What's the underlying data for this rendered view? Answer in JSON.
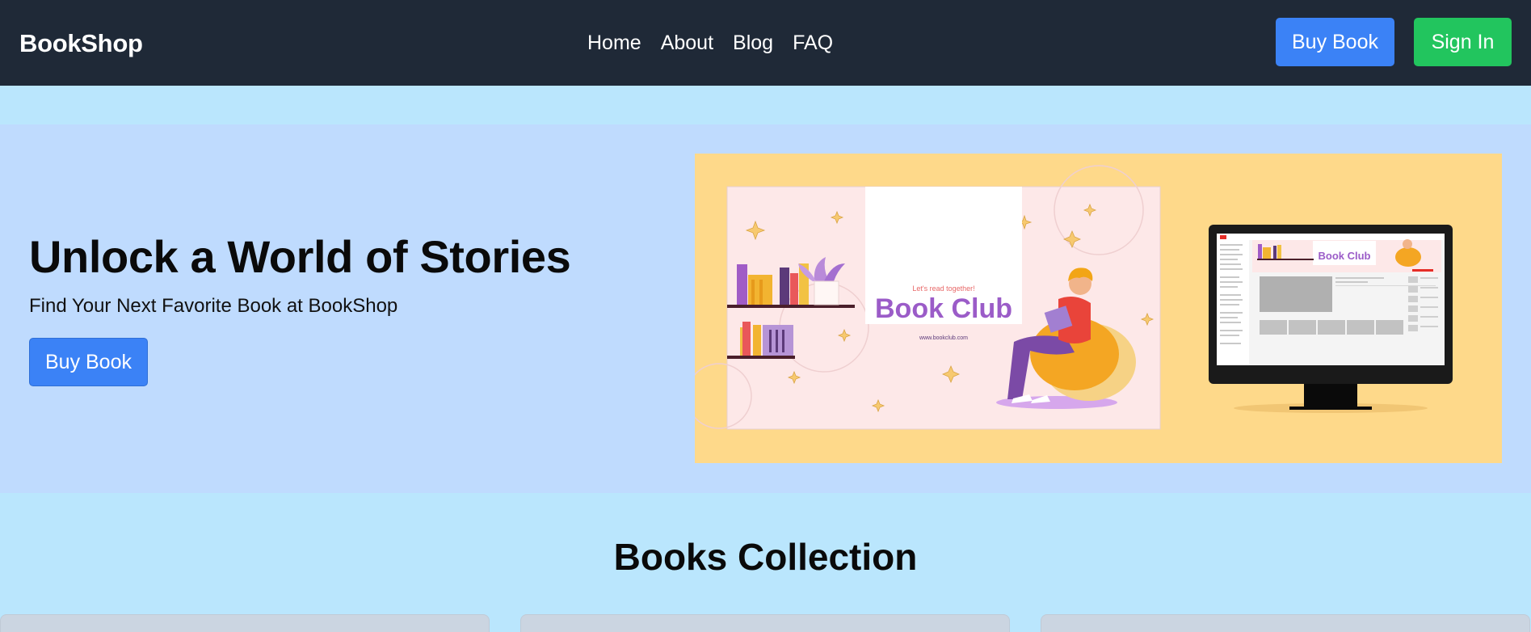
{
  "navbar": {
    "brand": "BookShop",
    "links": [
      "Home",
      "About",
      "Blog",
      "FAQ"
    ],
    "buy_label": "Buy Book",
    "signin_label": "Sign In"
  },
  "hero": {
    "title": "Unlock a World of Stories",
    "subtitle": "Find Your Next Favorite Book at BookShop",
    "button_label": "Buy Book",
    "image": {
      "tagline": "Let's read together!",
      "heading": "Book Club",
      "url": "www.bookclub.com"
    }
  },
  "collection": {
    "title": "Books Collection"
  },
  "colors": {
    "navbar_bg": "#1f2937",
    "primary": "#3b82f6",
    "success": "#22c55e",
    "page_bg": "#bae6fd",
    "hero_bg": "#bfdbfe",
    "image_bg": "#fed98a"
  }
}
